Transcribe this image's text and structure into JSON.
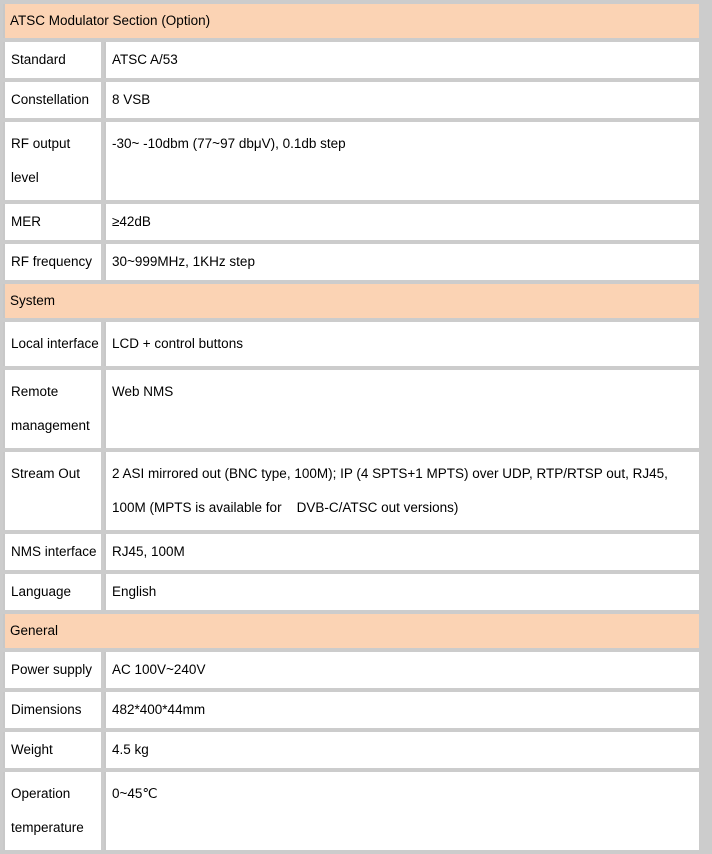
{
  "theme": {
    "page_background": "#cccccc",
    "cell_background": "#ffffff",
    "section_header_background": "#fbd3b4",
    "text_color": "#000000",
    "divider_color": "#c8c8c8"
  },
  "table": {
    "sections": [
      {
        "title": "ATSC Modulator Section (Option)",
        "rows": [
          {
            "label": "Standard",
            "value": "ATSC A/53"
          },
          {
            "label": "Constellation",
            "value": "8 VSB"
          },
          {
            "label": "RF output level",
            "value": "-30~ -10dbm (77~97 dbμV), 0.1db step"
          },
          {
            "label": "MER",
            "value": "≥42dB"
          },
          {
            "label": "RF frequency",
            "value": "30~999MHz, 1KHz step"
          }
        ]
      },
      {
        "title": "System",
        "rows": [
          {
            "label": "Local interface",
            "value": "LCD + control buttons"
          },
          {
            "label": "Remote management",
            "value": "Web NMS"
          },
          {
            "label": "Stream Out",
            "value": "2 ASI mirrored out (BNC type, 100M); IP (4 SPTS+1 MPTS) over UDP, RTP/RTSP out, RJ45, 100M (MPTS is available for    DVB-C/ATSC out versions)"
          },
          {
            "label": "NMS interface",
            "value": "RJ45, 100M"
          },
          {
            "label": "Language",
            "value": "English"
          }
        ]
      },
      {
        "title": "General",
        "rows": [
          {
            "label": "Power supply",
            "value": "AC 100V~240V"
          },
          {
            "label": "Dimensions",
            "value": "482*400*44mm"
          },
          {
            "label": "Weight",
            "value": "4.5 kg"
          },
          {
            "label": "Operation temperature",
            "value": "0~45℃"
          }
        ]
      }
    ]
  }
}
